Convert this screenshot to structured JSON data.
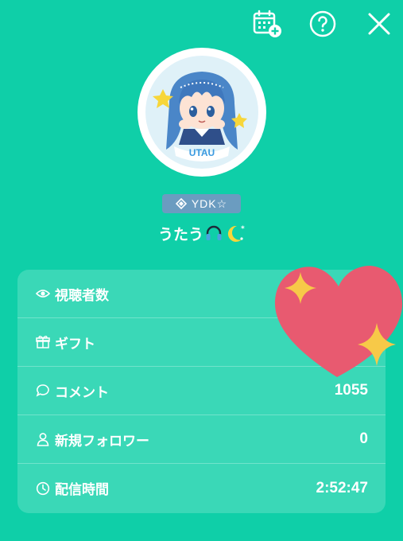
{
  "header": {
    "calendar_icon": "calendar-add-icon",
    "help_icon": "help-circle-icon",
    "close_icon": "close-icon"
  },
  "profile": {
    "avatar_logo_text": "UTAU",
    "badge_label": "YDK☆",
    "username": "うたう"
  },
  "stats": {
    "rows": [
      {
        "label": "視聴者数",
        "value": "",
        "icon": "eye-icon"
      },
      {
        "label": "ギフト",
        "value": "",
        "icon": "gift-icon"
      },
      {
        "label": "コメント",
        "value": "1055",
        "icon": "comment-icon"
      },
      {
        "label": "新規フォロワー",
        "value": "0",
        "icon": "person-icon"
      },
      {
        "label": "配信時間",
        "value": "2:52:47",
        "icon": "clock-icon"
      }
    ]
  },
  "colors": {
    "background": "#0fcfa8",
    "card": "#3ad8b7",
    "badge": "#6b9cc0",
    "heart": "#e85a70",
    "sparkle": "#f7c948"
  }
}
